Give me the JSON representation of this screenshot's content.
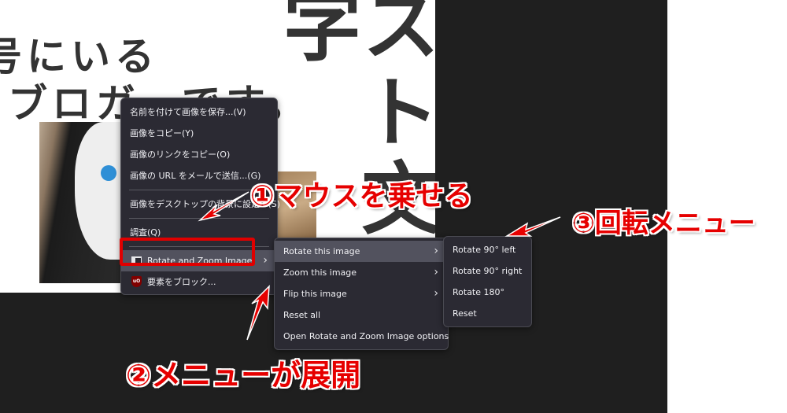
{
  "page": {
    "headline_line1": "号にいる",
    "headline_line2": "ブロガーです。",
    "vertical_title": "スト文字"
  },
  "context_menu": {
    "items": [
      {
        "label": "名前を付けて画像を保存...(V)"
      },
      {
        "label": "画像をコピー(Y)"
      },
      {
        "label": "画像のリンクをコピー(O)"
      },
      {
        "label": "画像の URL をメールで送信...(G)"
      },
      {
        "label": "画像をデスクトップの背景に設定...(S)"
      },
      {
        "label": "調査(Q)"
      },
      {
        "label": "Rotate and Zoom Image",
        "icon": "rotate-zoom-extension-icon",
        "has_submenu": true,
        "highlighted": true
      },
      {
        "label": "要素をブロック...",
        "icon": "ublock-origin-icon"
      }
    ]
  },
  "submenu": {
    "items": [
      {
        "label": "Rotate this image",
        "has_submenu": true,
        "highlighted": true
      },
      {
        "label": "Zoom this image",
        "has_submenu": true
      },
      {
        "label": "Flip this image",
        "has_submenu": true
      },
      {
        "label": "Reset all"
      },
      {
        "label": "Open Rotate and Zoom Image options"
      }
    ]
  },
  "rotate_submenu": {
    "items": [
      {
        "label": "Rotate 90° left"
      },
      {
        "label": "Rotate 90° right"
      },
      {
        "label": "Rotate 180°"
      },
      {
        "label": "Reset"
      }
    ]
  },
  "annotations": {
    "step1": "①マウスを乗せる",
    "step2": "②メニューが展開",
    "step3": "③回転メニュー",
    "color": "#e60000"
  },
  "icons": {
    "chevron": "›",
    "ublock_text": "uO"
  }
}
